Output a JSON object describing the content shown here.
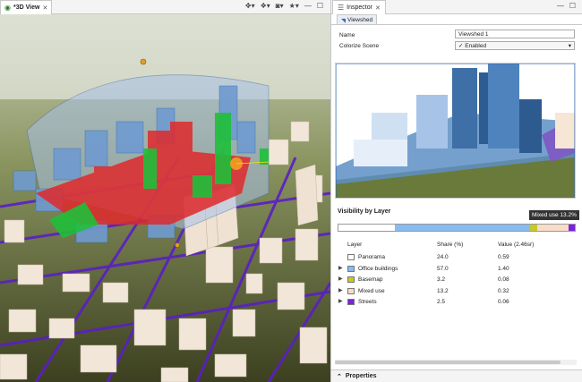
{
  "view_tab": {
    "title": "*3D View",
    "close": "✕"
  },
  "view_toolbar": {
    "icons": [
      "navigation-icon",
      "layers-icon",
      "camera-icon",
      "bookmark-star-icon"
    ],
    "minimize": "—",
    "maximize": "☐"
  },
  "inspector_tab": {
    "title": "Inspector",
    "close": "✕",
    "minimize": "—",
    "maximize": "☐"
  },
  "viewshed_tab": {
    "label": "Viewshed"
  },
  "form": {
    "name_label": "Name",
    "name_value": "Viewshed 1",
    "colorize_label": "Colorize Scene",
    "colorize_value": "✓ Enabled"
  },
  "visibility": {
    "title": "Visibility by Layer",
    "tooltip": "Mixed use 13.2%",
    "headers": {
      "layer": "Layer",
      "share": "Share (%)",
      "value": "Value (2.46sr)"
    },
    "rows": [
      {
        "name": "Panorama",
        "share": "24.0",
        "value": "0.59",
        "color": "#ffffff",
        "expandable": false
      },
      {
        "name": "Office buildings",
        "share": "57.0",
        "value": "1.40",
        "color": "#88bbf0",
        "expandable": true
      },
      {
        "name": "Basemap",
        "share": "3.2",
        "value": "0.08",
        "color": "#c8c829",
        "expandable": true
      },
      {
        "name": "Mixed use",
        "share": "13.2",
        "value": "0.32",
        "color": "#f8dcc8",
        "expandable": true
      },
      {
        "name": "Streets",
        "share": "2.5",
        "value": "0.06",
        "color": "#7b22e0",
        "expandable": true
      }
    ]
  },
  "properties": {
    "label": "Properties"
  }
}
